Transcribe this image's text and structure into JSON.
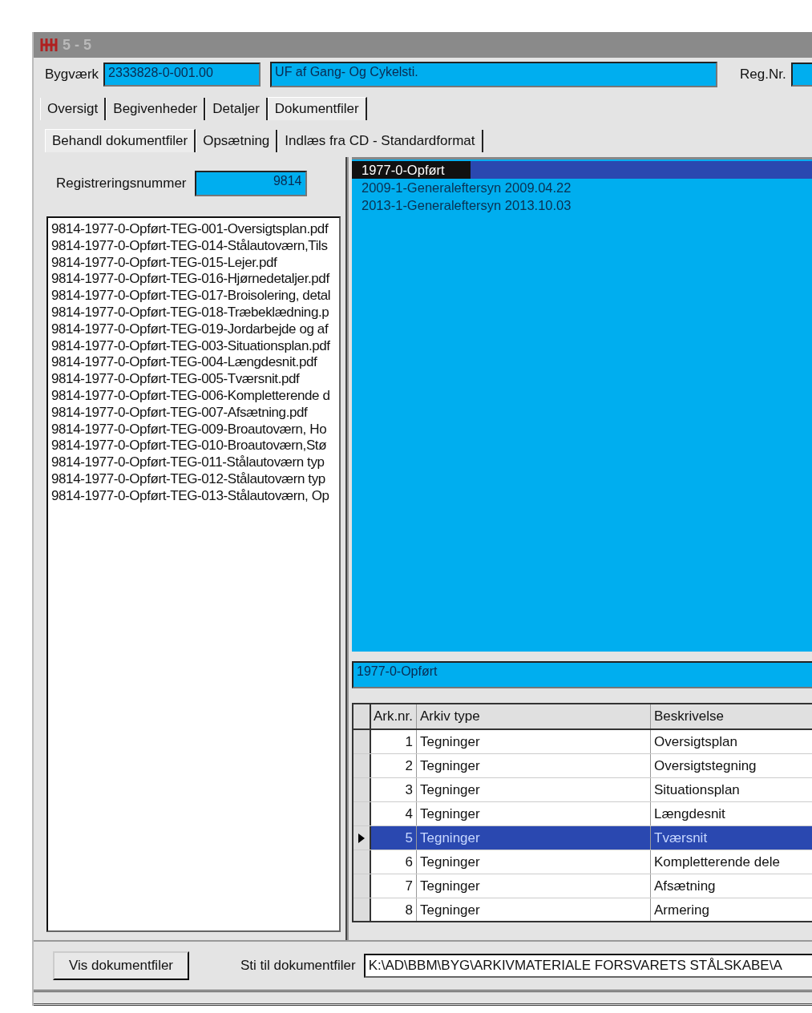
{
  "window": {
    "title": "5 - 5"
  },
  "header": {
    "bygvaerk_label": "Bygværk",
    "bygvaerk_value": "2333828-0-001.00",
    "name_value": "UF af  Gang- Og Cykelsti.",
    "regnr_label": "Reg.Nr."
  },
  "tabs": [
    {
      "label": "Oversigt",
      "selected": false
    },
    {
      "label": "Begivenheder",
      "selected": false
    },
    {
      "label": "Detaljer",
      "selected": false
    },
    {
      "label": "Dokumentfiler",
      "selected": true
    }
  ],
  "subtabs": [
    {
      "label": "Behandl dokumentfiler",
      "selected": true
    },
    {
      "label": "Opsætning",
      "selected": false
    },
    {
      "label": "Indlæs fra CD - Standardformat",
      "selected": false
    }
  ],
  "registration": {
    "label": "Registreringsnummer",
    "value": "9814"
  },
  "files": [
    "9814-1977-0-Opført-TEG-001-Oversigtsplan.pdf",
    "9814-1977-0-Opført-TEG-014-Stålautoværn,Tils",
    "9814-1977-0-Opført-TEG-015-Lejer.pdf",
    "9814-1977-0-Opført-TEG-016-Hjørnedetaljer.pdf",
    "9814-1977-0-Opført-TEG-017-Broisolering, detal",
    "9814-1977-0-Opført-TEG-018-Træbeklædning.p",
    "9814-1977-0-Opført-TEG-019-Jordarbejde og af",
    "9814-1977-0-Opført-TEG-003-Situationsplan.pdf",
    "9814-1977-0-Opført-TEG-004-Længdesnit.pdf",
    "9814-1977-0-Opført-TEG-005-Tværsnit.pdf",
    "9814-1977-0-Opført-TEG-006-Kompletterende d",
    "9814-1977-0-Opført-TEG-007-Afsætning.pdf",
    "9814-1977-0-Opført-TEG-009-Broautoværn, Ho",
    "9814-1977-0-Opført-TEG-010-Broautoværn,Stø",
    "9814-1977-0-Opført-TEG-011-Stålautoværn typ",
    "9814-1977-0-Opført-TEG-012-Stålautoværn typ",
    "9814-1977-0-Opført-TEG-013-Stålautoværn, Op"
  ],
  "events": [
    {
      "label": "1977-0-Opført",
      "selected": true
    },
    {
      "label": "2009-1-Generaleftersyn 2009.04.22",
      "selected": false
    },
    {
      "label": "2013-1-Generaleftersyn 2013.10.03",
      "selected": false
    }
  ],
  "selected_event": {
    "value": "1977-0-Opført"
  },
  "table": {
    "columns": [
      "Ark.nr.",
      "Arkiv type",
      "Beskrivelse"
    ],
    "rows": [
      {
        "cells": [
          "1",
          "Tegninger",
          "Oversigtsplan"
        ],
        "selected": false
      },
      {
        "cells": [
          "2",
          "Tegninger",
          "Oversigtstegning"
        ],
        "selected": false
      },
      {
        "cells": [
          "3",
          "Tegninger",
          "Situationsplan"
        ],
        "selected": false
      },
      {
        "cells": [
          "4",
          "Tegninger",
          "Længdesnit"
        ],
        "selected": false
      },
      {
        "cells": [
          "5",
          "Tegninger",
          "Tværsnit"
        ],
        "selected": true
      },
      {
        "cells": [
          "6",
          "Tegninger",
          "Kompletterende dele"
        ],
        "selected": false
      },
      {
        "cells": [
          "7",
          "Tegninger",
          "Afsætning"
        ],
        "selected": false
      },
      {
        "cells": [
          "8",
          "Tegninger",
          "Armering"
        ],
        "selected": false
      }
    ]
  },
  "footer": {
    "button": "Vis dokumentfiler",
    "path_label": "Sti til dokumentfiler",
    "path_value": "K:\\AD\\BBM\\BYG\\ARKIVMATERIALE FORSVARETS STÅLSKABE\\A"
  }
}
